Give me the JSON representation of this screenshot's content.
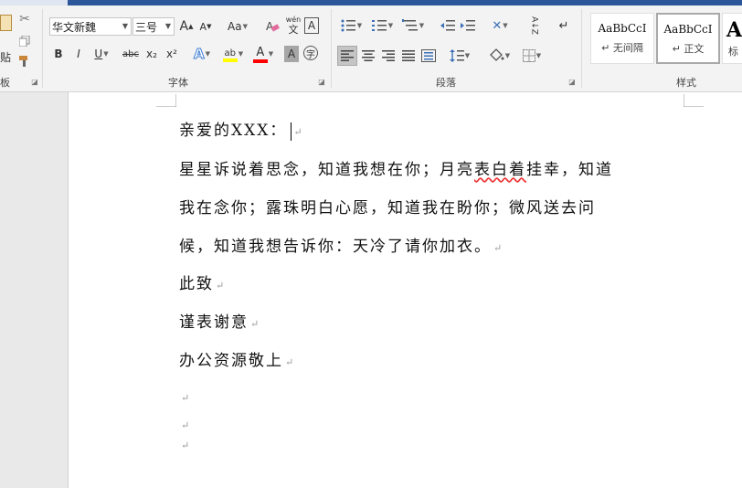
{
  "clipboard": {
    "paste_label": "贴",
    "group_label": "板"
  },
  "font": {
    "name": "华文新魏",
    "size": "三号",
    "grow": "A",
    "shrink": "A",
    "case": "Aa",
    "pinyin_top": "wén",
    "pinyin_bottom": "文",
    "border_char": "A",
    "bold": "B",
    "italic": "I",
    "underline": "U",
    "strike": "abc",
    "subscript": "x₂",
    "superscript": "x²",
    "text_effect": "A",
    "highlight": "ab",
    "font_color": "A",
    "char_shading": "A",
    "enclose": "字",
    "group_label": "字体"
  },
  "paragraph": {
    "group_label": "段落",
    "sort": "A↓Z",
    "marks": "↵"
  },
  "styles": {
    "group_label": "样式",
    "items": [
      {
        "sample": "AaBbCcI",
        "name": "无间隔"
      },
      {
        "sample": "AaBbCcI",
        "name": "正文"
      },
      {
        "sample": "A",
        "name": "标"
      }
    ]
  },
  "colors": {
    "highlight": "#ffff00",
    "font_color": "#ff0000",
    "accent": "#2b579a"
  },
  "document": {
    "lines": [
      {
        "text": "亲爱的XXX："
      },
      {
        "pre": "星星诉说着思念，知道我想在你；月亮",
        "err": "表白着",
        "post": "挂幸，知道"
      },
      {
        "text": "我在念你；露珠明白心愿，知道我在盼你；微风送去问"
      },
      {
        "text": "候，知道我想告诉你：天冷了请你加衣。"
      },
      {
        "text": "此致"
      },
      {
        "text": "谨表谢意"
      },
      {
        "text": "办公资源敬上"
      }
    ],
    "para_mark": "↵"
  }
}
